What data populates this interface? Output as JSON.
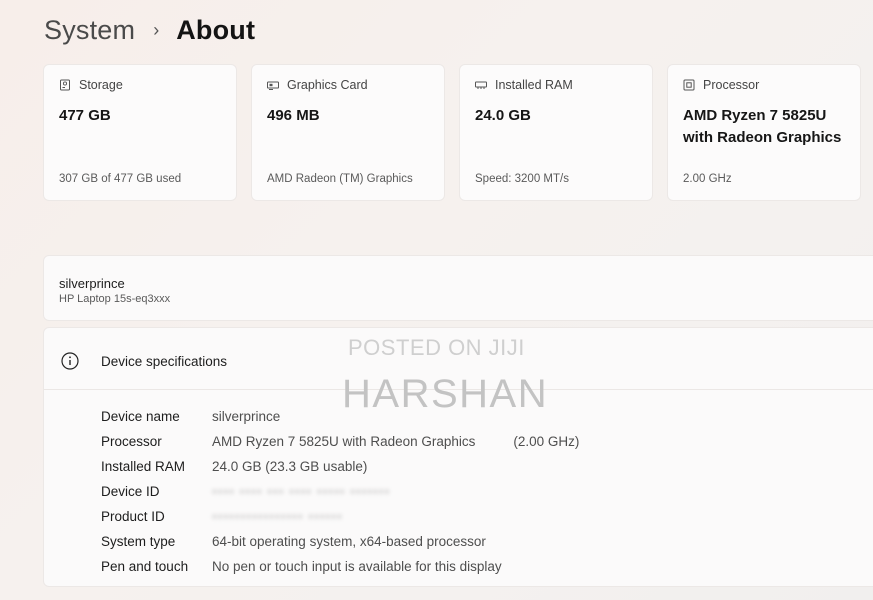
{
  "breadcrumb": {
    "parent": "System",
    "separator": "›",
    "current": "About"
  },
  "summary_cards": [
    {
      "icon": "storage-icon",
      "label": "Storage",
      "value": "477 GB",
      "sub": "307 GB of 477 GB used"
    },
    {
      "icon": "graphics-card-icon",
      "label": "Graphics Card",
      "value": "496 MB",
      "sub": "AMD Radeon (TM) Graphics"
    },
    {
      "icon": "ram-icon",
      "label": "Installed RAM",
      "value": "24.0 GB",
      "sub": "Speed: 3200 MT/s"
    },
    {
      "icon": "processor-icon",
      "label": "Processor",
      "value": "AMD Ryzen 7 5825U with Radeon Graphics",
      "sub": "2.00 GHz"
    }
  ],
  "device": {
    "hostname": "silverprince",
    "model": "HP Laptop 15s-eq3xxx"
  },
  "specs": {
    "title": "Device specifications",
    "rows": [
      {
        "key": "Device name",
        "value": "silverprince",
        "extra": ""
      },
      {
        "key": "Processor",
        "value": "AMD Ryzen 7 5825U with Radeon Graphics",
        "extra": "(2.00 GHz)"
      },
      {
        "key": "Installed RAM",
        "value": "24.0 GB (23.3 GB usable)",
        "extra": ""
      },
      {
        "key": "Device ID",
        "value": "•••• •••• ••• •••• ••••• •••••••",
        "extra": ""
      },
      {
        "key": "Product ID",
        "value": "•••••••••••••••• ••••••",
        "extra": ""
      },
      {
        "key": "System type",
        "value": "64-bit operating system, x64-based processor",
        "extra": ""
      },
      {
        "key": "Pen and touch",
        "value": "No pen or touch input is available for this display",
        "extra": ""
      }
    ]
  },
  "watermark": {
    "line1": "POSTED ON JIJI",
    "line2": "HARSHAN"
  }
}
